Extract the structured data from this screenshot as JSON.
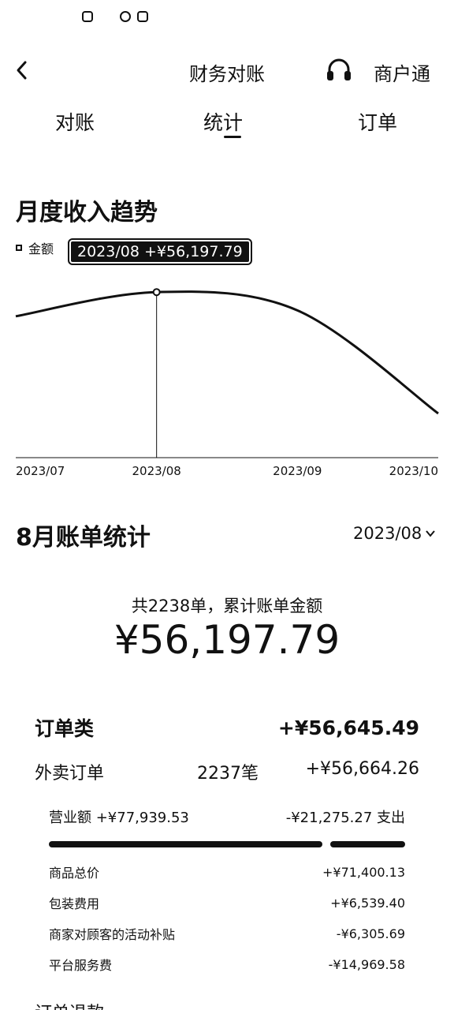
{
  "header": {
    "title": "财务对账",
    "merchant_link": "商户通"
  },
  "tabs": [
    {
      "label": "对账"
    },
    {
      "label": "统计"
    },
    {
      "label": "订单"
    }
  ],
  "trend": {
    "title": "月度收入趋势",
    "legend": "金额",
    "tooltip": "2023/08 +¥56,197.79"
  },
  "chart_data": {
    "type": "line",
    "x": [
      "2023/07",
      "2023/08",
      "2023/09",
      "2023/10"
    ],
    "series": [
      {
        "name": "金额",
        "values": [
          48000,
          56197.79,
          50000,
          15000
        ]
      }
    ],
    "ylim": [
      0,
      75000
    ],
    "grid": false,
    "legend_position": "top-left",
    "highlight": {
      "x": "2023/08",
      "label": "2023/08 +¥56,197.79"
    }
  },
  "bill": {
    "title": "8月账单统计",
    "month_select": "2023/08",
    "summary_text": "共2238单，累计账单金额",
    "total_amount": "¥56,197.79"
  },
  "orders": {
    "category_label": "订单类",
    "category_amount": "+¥56,645.49",
    "delivery_label": "外卖订单",
    "delivery_count": "2237笔",
    "delivery_amount": "+¥56,664.26",
    "revenue": "营业额 +¥77,939.53",
    "expense": "-¥21,275.27 支出",
    "items": [
      {
        "label": "商品总价",
        "amount": "+¥71,400.13"
      },
      {
        "label": "包装费用",
        "amount": "+¥6,539.40"
      },
      {
        "label": "商家对顾客的活动补贴",
        "amount": "-¥6,305.69"
      },
      {
        "label": "平台服务费",
        "amount": "-¥14,969.58"
      }
    ],
    "next_label": "订单退款"
  },
  "icons": {
    "back": "chevron-left-icon",
    "support": "headset-icon",
    "dropdown": "chevron-down-icon"
  }
}
